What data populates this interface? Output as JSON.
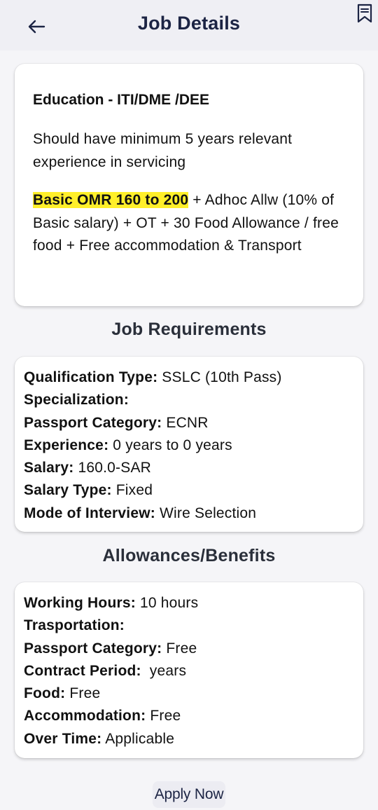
{
  "header": {
    "title": "Job Details",
    "back_icon": "arrow-left-icon",
    "bookmark_icon": "bookmark-icon"
  },
  "description": {
    "education": "Education - ITI/DME /DEE",
    "experience": "Should have minimum 5 years relevant experience in servicing",
    "salary_highlight": "Basic OMR 160 to 200",
    "salary_rest": " + Adhoc Allw (10% of Basic salary) + OT + 30 Food Allowance / free food + Free accommodation & Transport",
    "highlight_color": "#ffef2a"
  },
  "requirements": {
    "title": "Job Requirements",
    "rows": [
      {
        "label": "Qualification Type:",
        "value": " SSLC (10th Pass)"
      },
      {
        "label": "Specialization:",
        "value": ""
      },
      {
        "label": "Passport Category:",
        "value": " ECNR"
      },
      {
        "label": "Experience:",
        "value": " 0 years to 0 years"
      },
      {
        "label": "Salary:",
        "value": " 160.0-SAR"
      },
      {
        "label": "Salary Type:",
        "value": " Fixed"
      },
      {
        "label": "Mode of Interview:",
        "value": " Wire Selection"
      }
    ]
  },
  "benefits": {
    "title": "Allowances/Benefits",
    "rows": [
      {
        "label": "Working Hours:",
        "value": " 10 hours"
      },
      {
        "label": "Trasportation:",
        "value": ""
      },
      {
        "label": "Passport Category:",
        "value": " Free"
      },
      {
        "label": "Contract Period:",
        "value": "  years"
      },
      {
        "label": "Food:",
        "value": " Free"
      },
      {
        "label": "Accommodation:",
        "value": " Free"
      },
      {
        "label": "Over Time:",
        "value": " Applicable"
      }
    ]
  },
  "apply_label": "Apply Now"
}
